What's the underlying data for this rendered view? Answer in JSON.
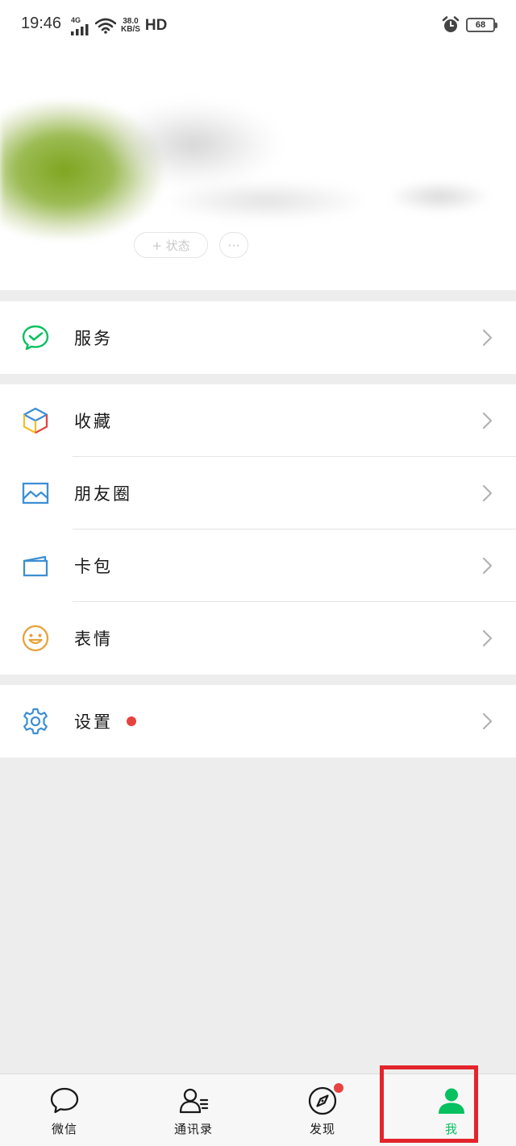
{
  "status_bar": {
    "time": "19:46",
    "network": "4G",
    "speed_value": "38.0",
    "speed_unit": "KB/S",
    "hd": "HD",
    "battery": "68"
  },
  "profile": {
    "status_button": "+ 状态",
    "more_button": "···"
  },
  "menu": {
    "service": {
      "label": "服务",
      "icon": "wechat-pay-icon",
      "color": "#07c160"
    },
    "favorites": {
      "label": "收藏",
      "icon": "cube-icon"
    },
    "moments": {
      "label": "朋友圈",
      "icon": "image-icon",
      "color": "#3c8fd4"
    },
    "cards": {
      "label": "卡包",
      "icon": "wallet-icon",
      "color": "#3c8fd4"
    },
    "stickers": {
      "label": "表情",
      "icon": "smiley-icon",
      "color": "#e6a23c"
    },
    "settings": {
      "label": "设置",
      "icon": "gear-icon",
      "color": "#3c8fd4",
      "has_badge": true
    }
  },
  "tabbar": {
    "tabs": [
      {
        "label": "微信",
        "icon": "chat-bubble-icon"
      },
      {
        "label": "通讯录",
        "icon": "contacts-icon"
      },
      {
        "label": "发现",
        "icon": "compass-icon",
        "has_badge": true
      },
      {
        "label": "我",
        "icon": "person-icon",
        "active": true
      }
    ],
    "active_color": "#07c160",
    "highlight_color": "#e3242b"
  }
}
